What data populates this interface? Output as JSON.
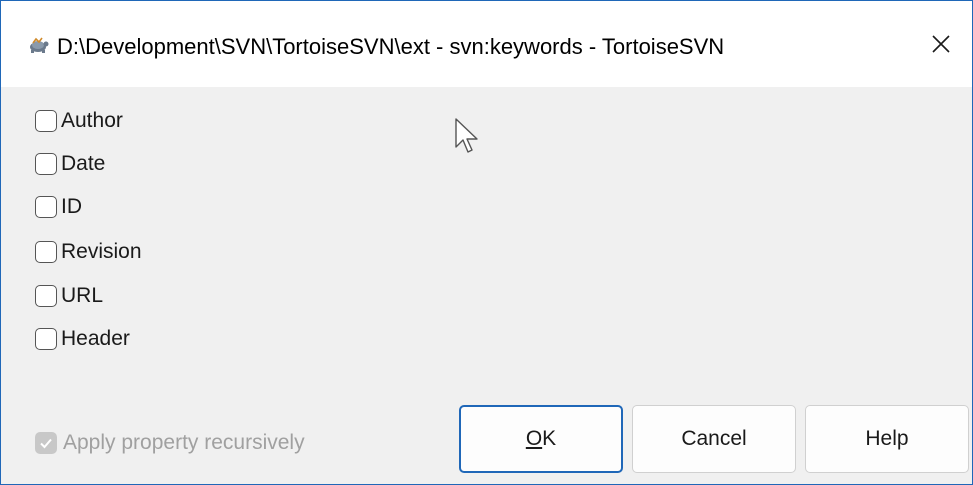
{
  "window": {
    "title": "D:\\Development\\SVN\\TortoiseSVN\\ext - svn:keywords - TortoiseSVN",
    "icon": "tortoise-icon",
    "close_icon": "close-icon"
  },
  "keywords": [
    {
      "label": "Author",
      "checked": false
    },
    {
      "label": "Date",
      "checked": false
    },
    {
      "label": "ID",
      "checked": false
    },
    {
      "label": "Revision",
      "checked": false
    },
    {
      "label": "URL",
      "checked": false
    },
    {
      "label": "Header",
      "checked": false
    }
  ],
  "recursive": {
    "label": "Apply property recursively",
    "checked": true,
    "enabled": false
  },
  "buttons": {
    "ok_mnemonic": "O",
    "ok_rest": "K",
    "cancel": "Cancel",
    "help": "Help"
  },
  "colors": {
    "accent": "#1f67b8",
    "dialog_bg": "#f0f0f0",
    "disabled_text": "#a0a0a0"
  }
}
